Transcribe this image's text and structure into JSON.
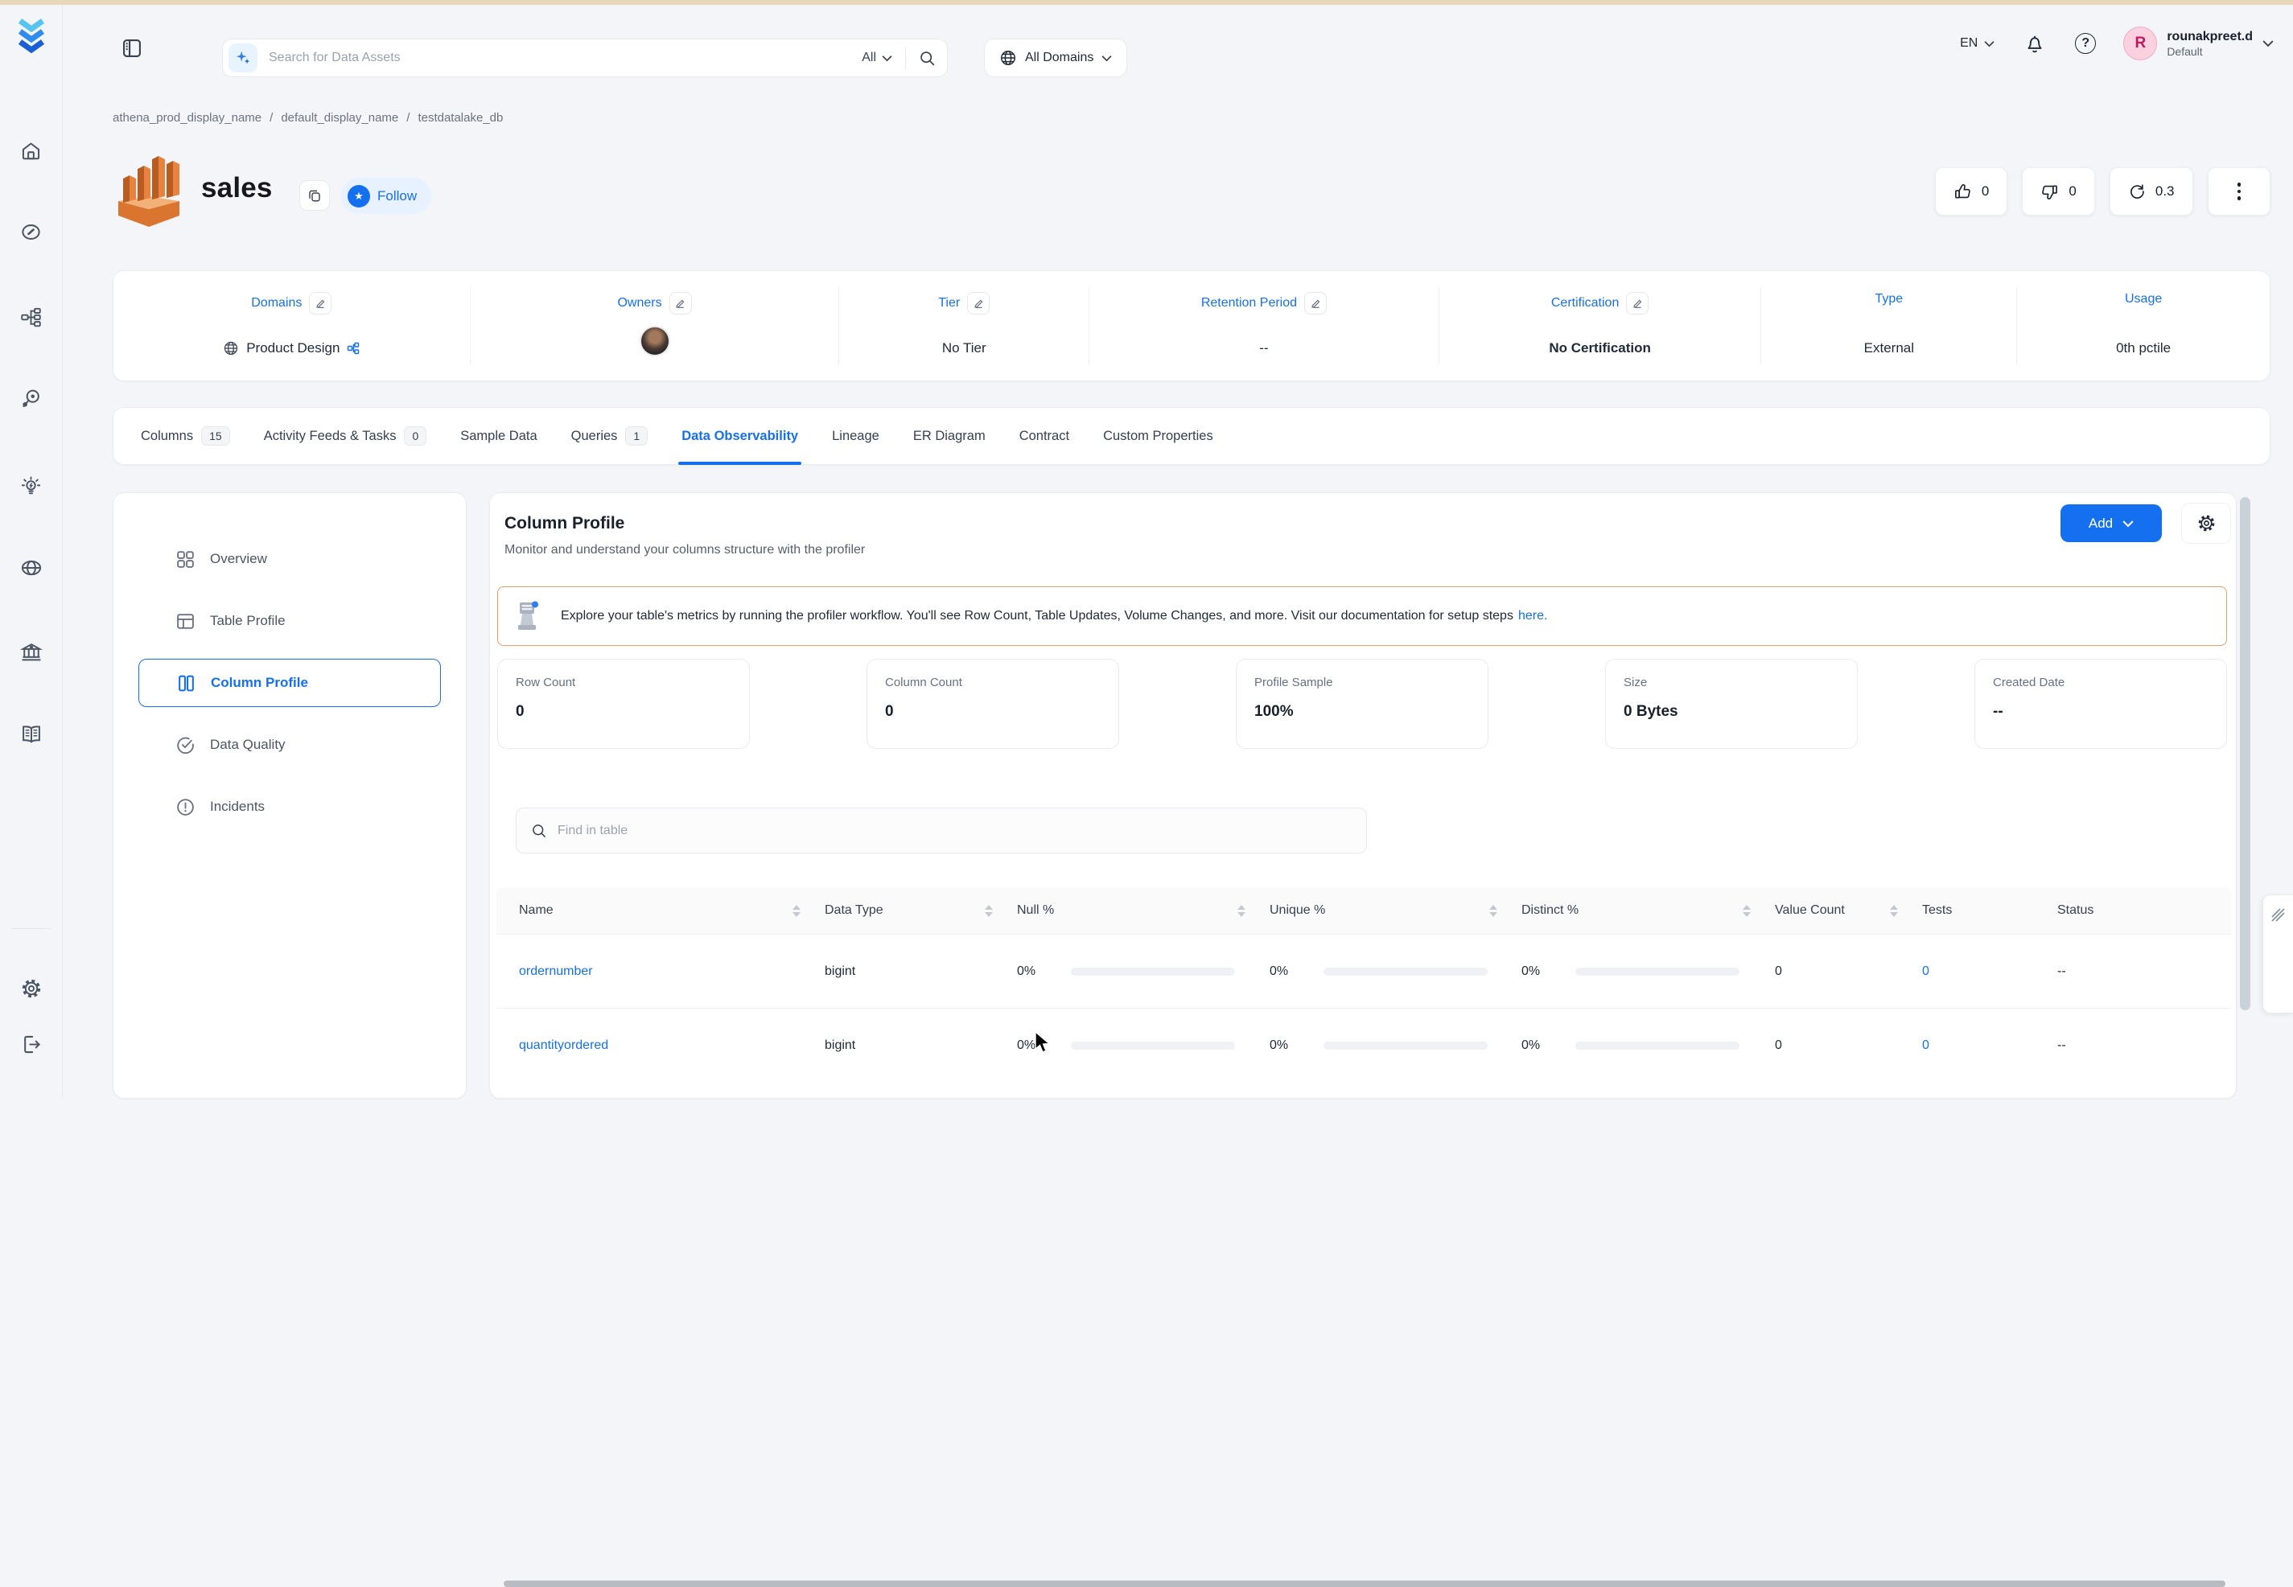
{
  "topbar": {
    "search_placeholder": "Search for Data Assets",
    "search_scope": "All",
    "domains_label": "All Domains",
    "language": "EN",
    "user": {
      "initial": "R",
      "name": "rounakpreet.d",
      "team": "Default"
    }
  },
  "breadcrumb": {
    "separator": "/",
    "items": [
      "athena_prod_display_name",
      "default_display_name",
      "testdatalake_db"
    ]
  },
  "entity": {
    "title": "sales",
    "follow_label": "Follow",
    "upvotes": "0",
    "downvotes": "0",
    "version": "0.3"
  },
  "metadata": {
    "domains": {
      "label": "Domains",
      "value": "Product Design"
    },
    "owners": {
      "label": "Owners"
    },
    "tier": {
      "label": "Tier",
      "value": "No Tier"
    },
    "retention": {
      "label": "Retention Period",
      "value": "--"
    },
    "certification": {
      "label": "Certification",
      "value": "No Certification"
    },
    "type": {
      "label": "Type",
      "value": "External"
    },
    "usage": {
      "label": "Usage",
      "value": "0th pctile"
    }
  },
  "tabs": [
    {
      "label": "Columns",
      "count": "15"
    },
    {
      "label": "Activity Feeds & Tasks",
      "count": "0"
    },
    {
      "label": "Sample Data"
    },
    {
      "label": "Queries",
      "count": "1"
    },
    {
      "label": "Data Observability",
      "active": true
    },
    {
      "label": "Lineage"
    },
    {
      "label": "ER Diagram"
    },
    {
      "label": "Contract"
    },
    {
      "label": "Custom Properties"
    }
  ],
  "profiler_nav": [
    {
      "label": "Overview"
    },
    {
      "label": "Table Profile"
    },
    {
      "label": "Column Profile",
      "active": true
    },
    {
      "label": "Data Quality"
    },
    {
      "label": "Incidents"
    }
  ],
  "profiler": {
    "title": "Column Profile",
    "subtitle": "Monitor and understand your columns structure with the profiler",
    "add_label": "Add",
    "banner_text": "Explore your table's metrics by running the profiler workflow. You'll see Row Count, Table Updates, Volume Changes, and more. Visit our documentation for setup steps",
    "banner_link": "here.",
    "stats": [
      {
        "label": "Row Count",
        "value": "0"
      },
      {
        "label": "Column Count",
        "value": "0"
      },
      {
        "label": "Profile Sample",
        "value": "100%"
      },
      {
        "label": "Size",
        "value": "0 Bytes"
      },
      {
        "label": "Created Date",
        "value": "--"
      }
    ]
  },
  "table": {
    "search_placeholder": "Find in table",
    "columns": [
      "Name",
      "Data Type",
      "Null %",
      "Unique %",
      "Distinct %",
      "Value Count",
      "Tests",
      "Status"
    ],
    "rows": [
      {
        "name": "ordernumber",
        "data_type": "bigint",
        "null_pct": "0%",
        "unique_pct": "0%",
        "distinct_pct": "0%",
        "value_count": "0",
        "tests": "0",
        "status": "--"
      },
      {
        "name": "quantityordered",
        "data_type": "bigint",
        "null_pct": "0%",
        "unique_pct": "0%",
        "distinct_pct": "0%",
        "value_count": "0",
        "tests": "0",
        "status": "--"
      }
    ]
  },
  "colors": {
    "accent": "#1570ef",
    "banner_border": "#ec9f63",
    "top_strip": "#e9d7bc",
    "table_header_bg": "#fafafa",
    "scrollbar": "#cbd1d9"
  }
}
